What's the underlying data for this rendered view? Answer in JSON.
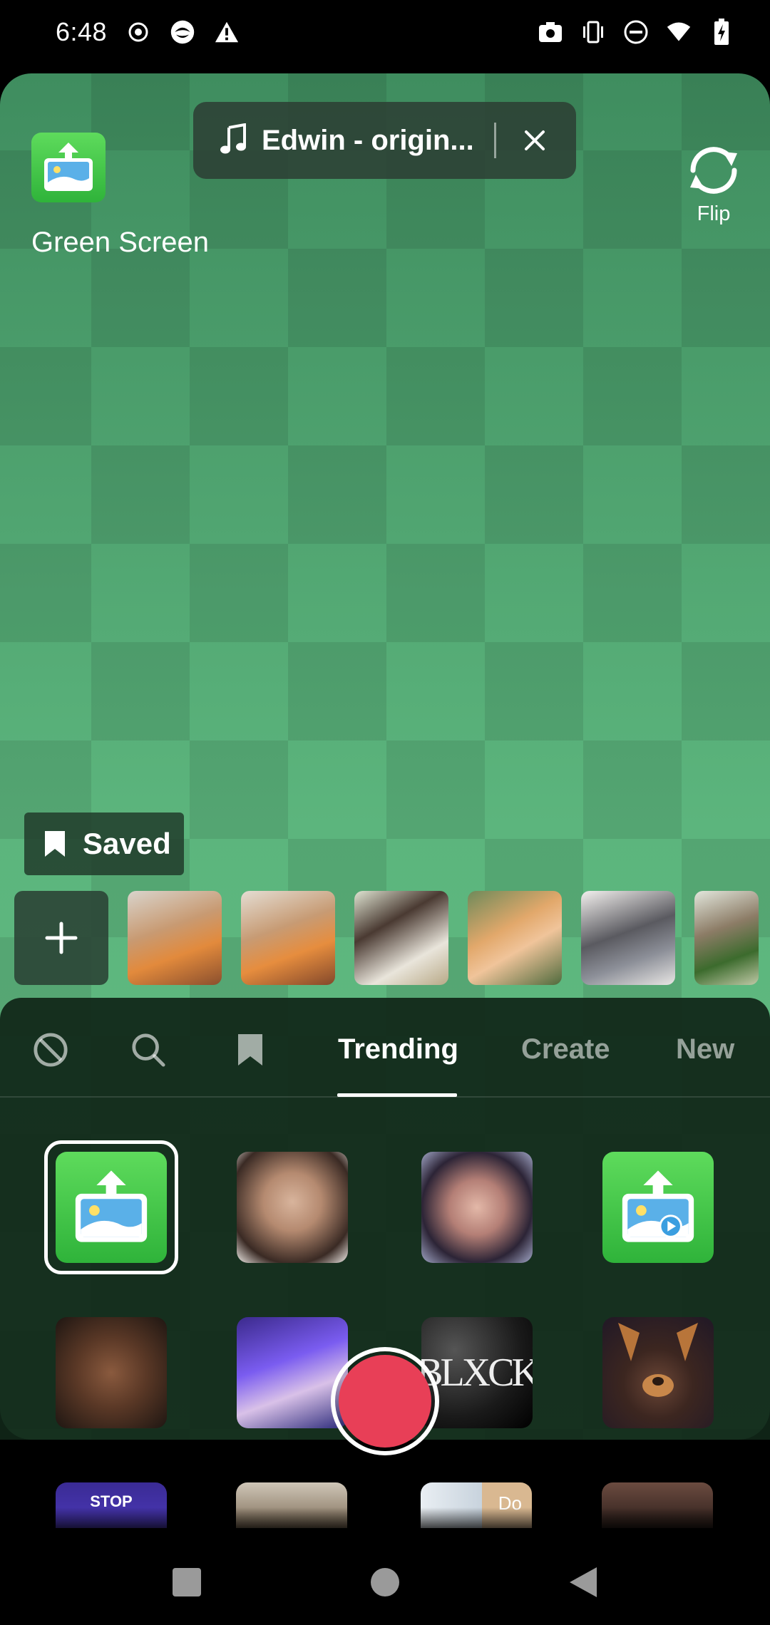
{
  "status_bar": {
    "time": "6:48",
    "left_icons": [
      "record-icon",
      "app-icon",
      "warning-icon"
    ],
    "right_icons": [
      "screenshot-icon",
      "vibrate-icon",
      "dnd-icon",
      "wifi-icon",
      "battery-icon"
    ]
  },
  "camera": {
    "effect_name": "Green Screen",
    "effect_icon": "image-upload-icon",
    "music": {
      "title": "Edwin - origin...",
      "icon": "music-note-icon",
      "close_icon": "close-icon"
    },
    "flip_label": "Flip",
    "saved_label": "Saved"
  },
  "photo_strip": {
    "add_icon": "plus-icon",
    "photos": [
      "photo-1",
      "photo-2",
      "photo-3",
      "photo-4",
      "photo-5",
      "photo-6"
    ]
  },
  "effects_panel": {
    "tabs": [
      {
        "icon": "none-icon"
      },
      {
        "icon": "search-icon"
      },
      {
        "icon": "bookmark-icon"
      },
      {
        "label": "Trending",
        "active": true
      },
      {
        "label": "Create"
      },
      {
        "label": "New"
      }
    ],
    "grid": [
      "green-screen-photo-effect",
      "face-effect-1",
      "face-effect-2",
      "green-screen-video-effect",
      "face-effect-3",
      "face-effect-4",
      "blck-effect",
      "puppy-ears-effect"
    ],
    "blck_text": "BLXCK"
  },
  "peek_row": {
    "stop_text": "STOP",
    "do_text": "Do"
  },
  "colors": {
    "record": "#e83f57",
    "green_icon": "#3fc645",
    "panel_bg": "#10261a"
  },
  "navbar": {
    "buttons": [
      "recents-button",
      "home-button",
      "back-button"
    ]
  }
}
